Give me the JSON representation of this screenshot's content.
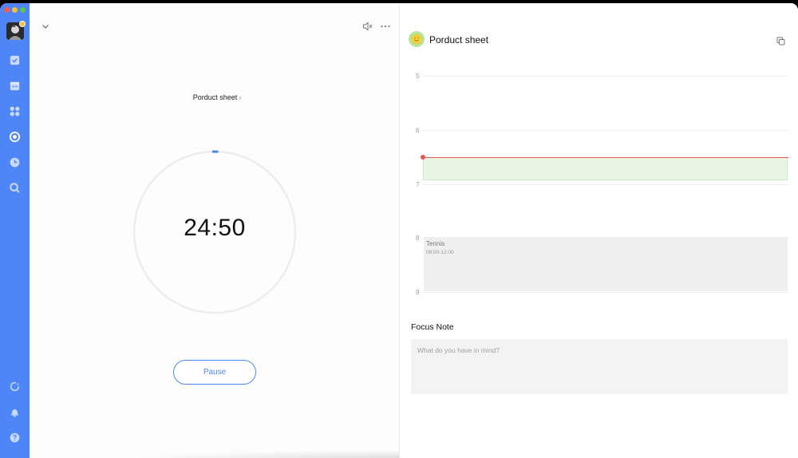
{
  "sidebar": {
    "nav": [
      {
        "name": "tasks",
        "icon": "checkbox-icon"
      },
      {
        "name": "calendar",
        "icon": "calendar-icon"
      },
      {
        "name": "matrix",
        "icon": "grid-icon"
      },
      {
        "name": "focus",
        "icon": "pomodoro-icon",
        "active": true
      },
      {
        "name": "habit",
        "icon": "clock-icon"
      },
      {
        "name": "search",
        "icon": "search-icon"
      }
    ],
    "bottom": [
      {
        "name": "sync",
        "icon": "sync-icon"
      },
      {
        "name": "notifications",
        "icon": "bell-icon"
      },
      {
        "name": "help",
        "icon": "help-icon"
      }
    ]
  },
  "focus": {
    "task_name": "Porduct sheet",
    "task_chevron": "›",
    "timer": "24:50",
    "progress": 0.007,
    "pause_label": "Pause"
  },
  "detail": {
    "title": "Porduct sheet",
    "hours": [
      "5",
      "6",
      "7",
      "8",
      "9"
    ],
    "event": {
      "name": "Tennis",
      "time": "08:00-12:00"
    },
    "note_title": "Focus Note",
    "note_placeholder": "What do you have in mind?"
  },
  "colors": {
    "accent": "#4f86f7",
    "now_line": "#e8574b",
    "focus_block": "#e9f6e6",
    "event_block": "#efefef"
  }
}
